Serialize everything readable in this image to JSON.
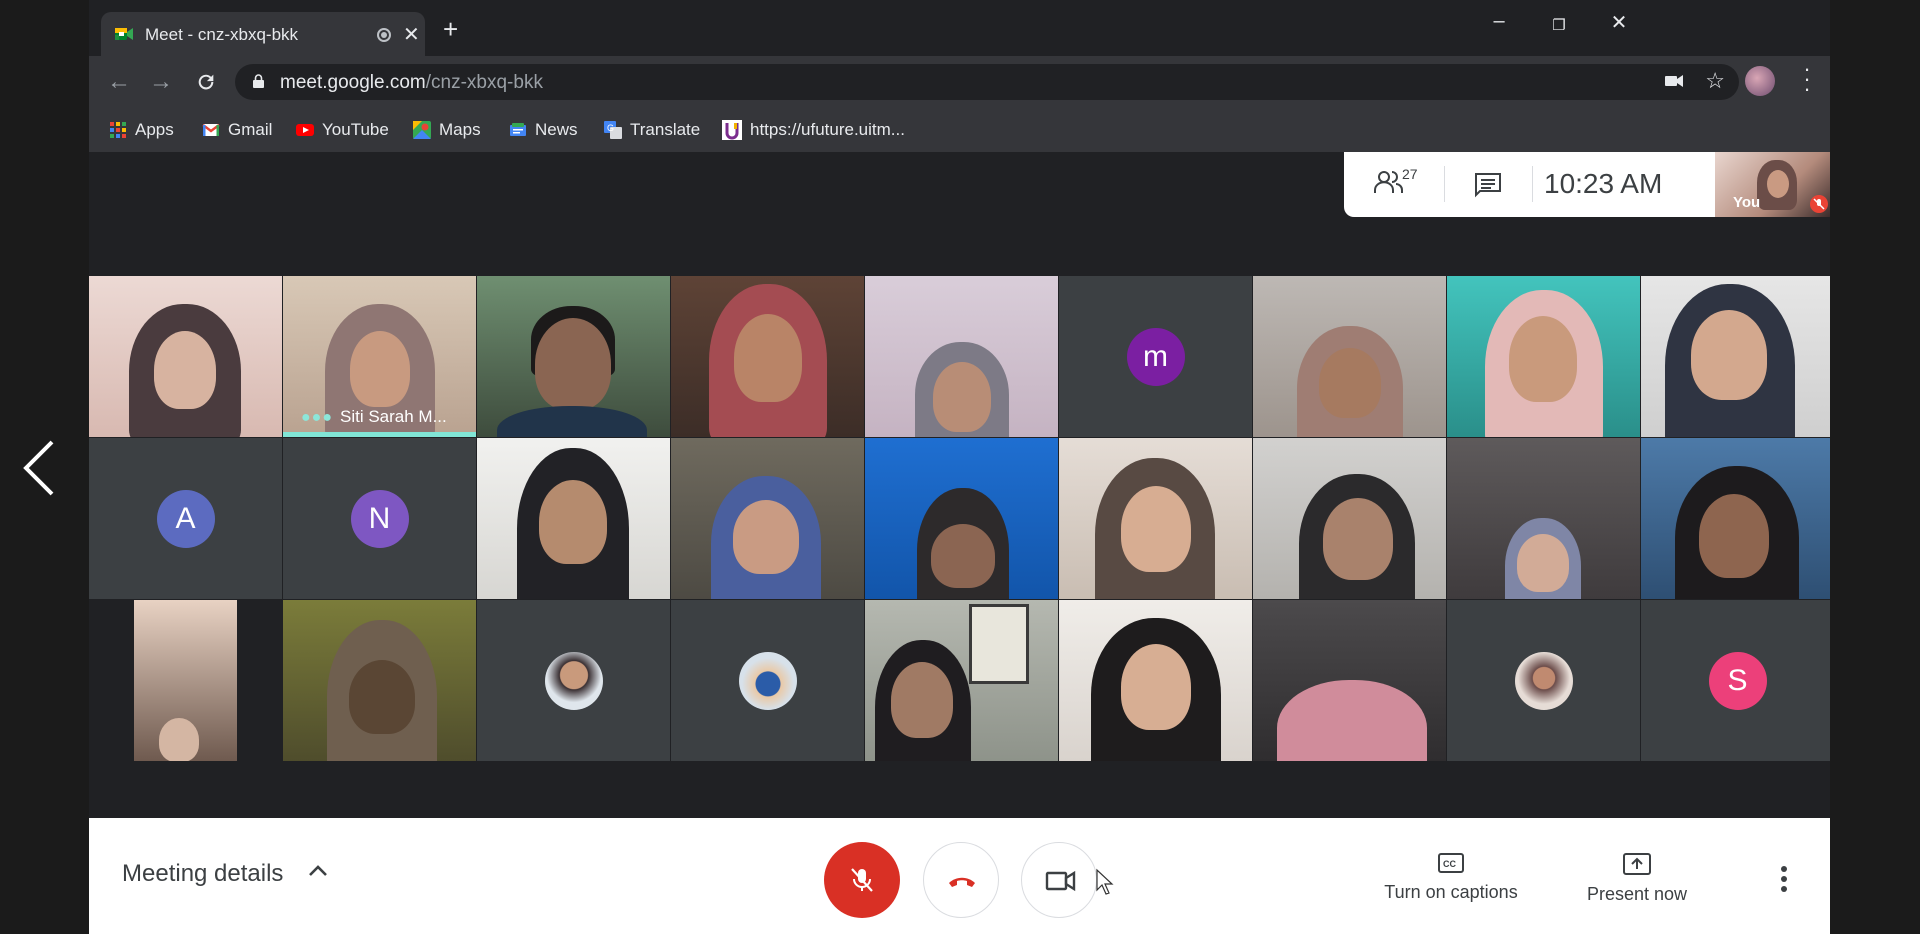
{
  "browser": {
    "tab_title": "Meet - cnz-xbxq-bkk",
    "url_host": "meet.google.com",
    "url_path": "/cnz-xbxq-bkk",
    "bookmarks": [
      {
        "label": "Apps",
        "icon": "apps-grid-icon"
      },
      {
        "label": "Gmail",
        "icon": "gmail-icon"
      },
      {
        "label": "YouTube",
        "icon": "youtube-icon"
      },
      {
        "label": "Maps",
        "icon": "maps-icon"
      },
      {
        "label": "News",
        "icon": "news-icon"
      },
      {
        "label": "Translate",
        "icon": "translate-icon"
      },
      {
        "label": "https://ufuture.uitm...",
        "icon": "ufuture-icon"
      }
    ]
  },
  "meeting": {
    "participant_count": "27",
    "time": "10:23  AM",
    "self_label": "You",
    "details_label": "Meeting details",
    "captions_label": "Turn on captions",
    "present_label": "Present now",
    "speaking_name": "Siti Sarah M...",
    "avatar_letters": {
      "m": "m",
      "a": "A",
      "n": "N",
      "s": "S"
    },
    "colors": {
      "hangup_red": "#d93025",
      "speaking_teal": "#81e6d6",
      "avatar_purple": "#7b1fa2",
      "avatar_indigo": "#5c6bc0",
      "avatar_violet": "#7e57c2",
      "avatar_pink": "#ec407a"
    }
  }
}
